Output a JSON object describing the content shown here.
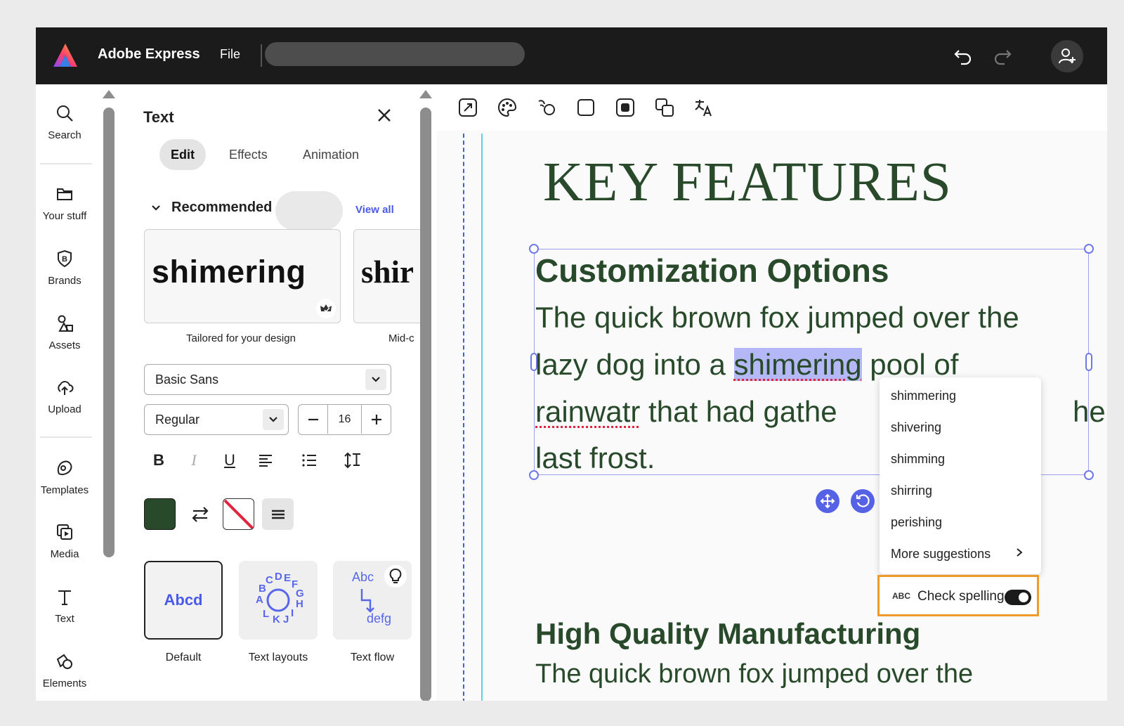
{
  "app": {
    "title": "Adobe Express",
    "file_menu": "File"
  },
  "rail": {
    "items": [
      {
        "label": "Search",
        "icon": "search-icon"
      },
      {
        "label": "Your stuff",
        "icon": "folder-icon"
      },
      {
        "label": "Brands",
        "icon": "brand-icon"
      },
      {
        "label": "Assets",
        "icon": "assets-icon"
      },
      {
        "label": "Upload",
        "icon": "upload-icon"
      },
      {
        "label": "Templates",
        "icon": "templates-icon"
      },
      {
        "label": "Media",
        "icon": "media-icon"
      },
      {
        "label": "Text",
        "icon": "text-icon"
      },
      {
        "label": "Elements",
        "icon": "elements-icon"
      }
    ]
  },
  "panel": {
    "title": "Text",
    "tabs": [
      {
        "label": "Edit",
        "active": true
      },
      {
        "label": "Effects"
      },
      {
        "label": "Animation"
      }
    ],
    "recommended_label": "Recommended",
    "view_all": "View all",
    "cards": [
      {
        "preview": "shimering",
        "caption": "Tailored for your design"
      },
      {
        "preview": "shir",
        "caption": "Mid-c"
      }
    ],
    "font_family": "Basic Sans",
    "font_weight": "Regular",
    "font_size": "16",
    "format": {
      "bold": "B",
      "italic": "I",
      "underline": "U"
    },
    "text_color": "#284a2b",
    "styles": [
      {
        "caption": "Default",
        "preview": "Abcd"
      },
      {
        "caption": "Text layouts",
        "preview": "ABCDEFGHIJKL"
      },
      {
        "caption": "Text flow",
        "preview_top": "Abc",
        "preview_bottom": "defg"
      }
    ]
  },
  "canvas": {
    "heading": "KEY FEATURES",
    "section1_title": "Customization Options",
    "line1": "The quick brown fox jumped over the",
    "line2_pre": "lazy dog into a ",
    "line2_word": "shimering",
    "line2_post": " pool of",
    "line3_word": "rainwatr",
    "line3_post": " that had gathe",
    "line3_tail": "he",
    "line4": "last frost.",
    "section2_title": "High Quality Manufacturing",
    "line5": "The quick brown fox jumped over the"
  },
  "spell_menu": {
    "suggestions": [
      "shimmering",
      "shivering",
      "shimming",
      "shirring",
      "perishing"
    ],
    "more": "More suggestions",
    "check_icon_text": "ABC",
    "check_label": "Check spelling",
    "check_enabled": true
  }
}
